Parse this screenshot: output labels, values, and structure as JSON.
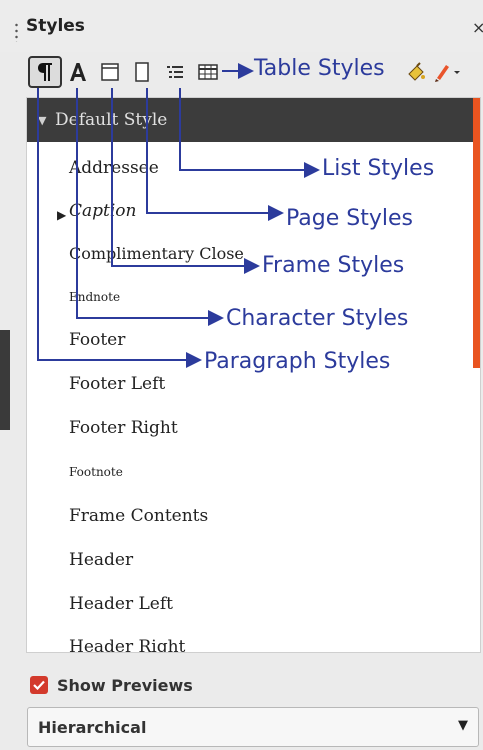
{
  "panel": {
    "title": "Styles",
    "close_glyph": "×"
  },
  "toolbar": {
    "buttons": [
      {
        "name": "paragraph-styles",
        "icon": "pilcrow-icon",
        "active": true
      },
      {
        "name": "character-styles",
        "icon": "letter-a-icon"
      },
      {
        "name": "frame-styles",
        "icon": "frame-icon"
      },
      {
        "name": "page-styles",
        "icon": "page-icon"
      },
      {
        "name": "list-styles",
        "icon": "list-icon"
      },
      {
        "name": "table-styles",
        "icon": "table-icon"
      },
      {
        "name": "fill-format-mode",
        "icon": "paint-bucket-icon"
      },
      {
        "name": "new-style-menu",
        "icon": "brush-icon"
      }
    ]
  },
  "styles_list": {
    "items": [
      {
        "label": "Default Style",
        "selected": true,
        "expander": "expanded"
      },
      {
        "label": "Addressee"
      },
      {
        "label": "Caption",
        "italic": true,
        "expander": "collapsed"
      },
      {
        "label": "Complimentary Close"
      },
      {
        "label": "Endnote"
      },
      {
        "label": "Footer"
      },
      {
        "label": "Footer Left"
      },
      {
        "label": "Footer Right"
      },
      {
        "label": "Footnote"
      },
      {
        "label": "Frame Contents"
      },
      {
        "label": "Header"
      },
      {
        "label": "Header Left"
      },
      {
        "label": "Header Right"
      }
    ],
    "scrollbar_color": "#e95420"
  },
  "show_previews": {
    "label": "Show Previews",
    "checked": true,
    "color": "#d33a2c"
  },
  "filter_select": {
    "value": "Hierarchical",
    "arrow": "▼"
  },
  "annotations": {
    "color": "#2c3b9c",
    "table_styles": "Table Styles",
    "list_styles": "List Styles",
    "page_styles": "Page Styles",
    "frame_styles": "Frame Styles",
    "character_styles": "Character Styles",
    "paragraph_styles": "Paragraph Styles"
  }
}
